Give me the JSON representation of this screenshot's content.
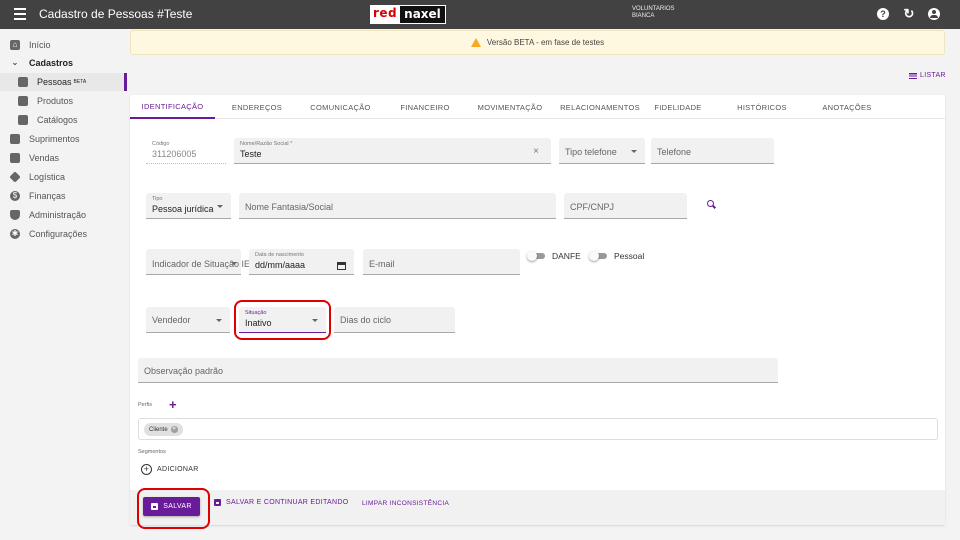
{
  "header": {
    "title": "Cadastro de Pessoas #Teste",
    "logo_red": "red",
    "logo_dark": "naxel",
    "user_line1": "VOLUNTARIOS",
    "user_line2": "BIANCA",
    "help_icon": "help-icon",
    "refresh_icon": "refresh-icon",
    "account_icon": "account-icon"
  },
  "sidebar": {
    "items": [
      {
        "label": "Início",
        "icon": "home-icon"
      },
      {
        "label": "Cadastros",
        "icon": "chevron-down-icon"
      },
      {
        "label": "Pessoas",
        "badge": "BETA",
        "icon": "people-icon"
      },
      {
        "label": "Produtos",
        "icon": "products-icon"
      },
      {
        "label": "Catálogos",
        "icon": "list-icon"
      },
      {
        "label": "Suprimentos",
        "icon": "briefcase-icon"
      },
      {
        "label": "Vendas",
        "icon": "cart-icon"
      },
      {
        "label": "Logística",
        "icon": "diamond-icon"
      },
      {
        "label": "Finanças",
        "icon": "money-icon"
      },
      {
        "label": "Administração",
        "icon": "shield-icon"
      },
      {
        "label": "Configurações",
        "icon": "gear-icon"
      }
    ]
  },
  "banner": {
    "text": "Versão BETA - em fase de testes"
  },
  "list_button": "LISTAR",
  "tabs": [
    "IDENTIFICAÇÃO",
    "ENDEREÇOS",
    "COMUNICAÇÃO",
    "FINANCEIRO",
    "MOVIMENTAÇÃO",
    "RELACIONAMENTOS",
    "FIDELIDADE",
    "HISTÓRICOS",
    "ANOTAÇÕES"
  ],
  "form": {
    "codigo": {
      "label": "Código",
      "value": "311206005"
    },
    "nome": {
      "label": "Nome/Razão Social *",
      "value": "Teste"
    },
    "tipo_telefone": {
      "placeholder": "Tipo telefone"
    },
    "telefone": {
      "placeholder": "Telefone"
    },
    "tipo": {
      "label": "Tipo",
      "value": "Pessoa jurídica"
    },
    "nome_fantasia": {
      "placeholder": "Nome Fantasia/Social"
    },
    "cpf_cnpj": {
      "placeholder": "CPF/CNPJ"
    },
    "indicador_ie": {
      "placeholder": "Indicador de Situação IE"
    },
    "data_nascimento": {
      "label": "Data de nascimento",
      "value": "dd/mm/aaaa"
    },
    "email": {
      "placeholder": "E-mail"
    },
    "danfe": "DANFE",
    "pessoal": "Pessoal",
    "vendedor": {
      "placeholder": "Vendedor"
    },
    "situacao": {
      "label": "Situação",
      "value": "Inativo"
    },
    "dias_ciclo": {
      "placeholder": "Dias do ciclo"
    },
    "observacao": {
      "placeholder": "Observação padrão"
    },
    "perfis_label": "Perfis",
    "perfil_chip": "Cliente",
    "segmentos_label": "Segmentos",
    "adicionar": "ADICIONAR"
  },
  "footer": {
    "salvar": "SALVAR",
    "salvar_continuar": "SALVAR E CONTINUAR EDITANDO",
    "limpar": "LIMPAR INCONSISTÊNCIA"
  },
  "colors": {
    "accent": "#6a1b9a",
    "topbar": "#424242",
    "highlight": "#e00000"
  }
}
